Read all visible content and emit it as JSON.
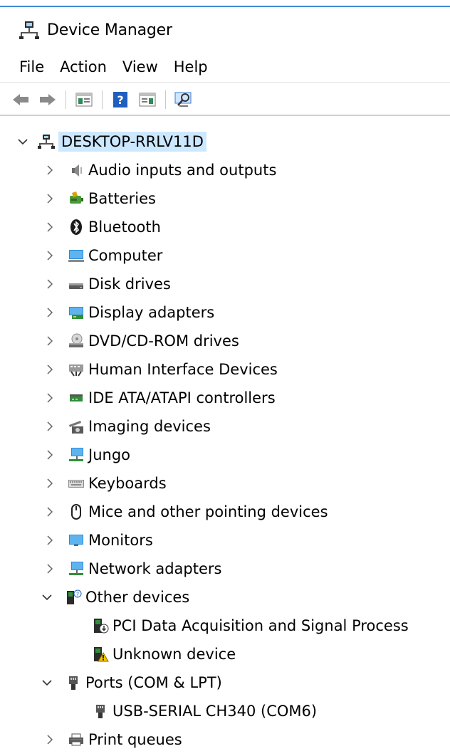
{
  "window": {
    "title": "Device Manager",
    "title_icon": "device-manager-icon"
  },
  "menu": [
    "File",
    "Action",
    "View",
    "Help"
  ],
  "toolbar": {
    "buttons": [
      "back-arrow-icon",
      "forward-arrow-icon",
      "show-hide-console-tree-icon",
      "help-icon",
      "show-hide-action-pane-icon",
      "scan-for-hardware-changes-icon"
    ]
  },
  "tree": {
    "root": {
      "label": "DESKTOP-RRLV11D",
      "expanded": true,
      "icon": "computer-network-icon",
      "selected": true
    },
    "categories": [
      {
        "label": "Audio inputs and outputs",
        "icon": "speaker-icon",
        "expanded": false
      },
      {
        "label": "Batteries",
        "icon": "battery-icon",
        "expanded": false
      },
      {
        "label": "Bluetooth",
        "icon": "bluetooth-icon",
        "expanded": false
      },
      {
        "label": "Computer",
        "icon": "computer-icon",
        "expanded": false
      },
      {
        "label": "Disk drives",
        "icon": "disk-drive-icon",
        "expanded": false
      },
      {
        "label": "Display adapters",
        "icon": "display-adapter-icon",
        "expanded": false
      },
      {
        "label": "DVD/CD-ROM drives",
        "icon": "dvd-drive-icon",
        "expanded": false
      },
      {
        "label": "Human Interface Devices",
        "icon": "hid-icon",
        "expanded": false
      },
      {
        "label": "IDE ATA/ATAPI controllers",
        "icon": "ide-controller-icon",
        "expanded": false
      },
      {
        "label": "Imaging devices",
        "icon": "camera-icon",
        "expanded": false
      },
      {
        "label": "Jungo",
        "icon": "network-device-icon",
        "expanded": false
      },
      {
        "label": "Keyboards",
        "icon": "keyboard-icon",
        "expanded": false
      },
      {
        "label": "Mice and other pointing devices",
        "icon": "mouse-icon",
        "expanded": false
      },
      {
        "label": "Monitors",
        "icon": "monitor-icon",
        "expanded": false
      },
      {
        "label": "Network adapters",
        "icon": "network-adapter-icon",
        "expanded": false
      },
      {
        "label": "Other devices",
        "icon": "unknown-device-category-icon",
        "expanded": true,
        "children": [
          {
            "label": "PCI Data Acquisition and Signal Process",
            "icon": "pci-device-icon"
          },
          {
            "label": "Unknown device",
            "icon": "warning-device-icon"
          }
        ]
      },
      {
        "label": "Ports (COM & LPT)",
        "icon": "port-icon",
        "expanded": true,
        "children": [
          {
            "label": "USB-SERIAL CH340 (COM6)",
            "icon": "port-icon"
          }
        ]
      },
      {
        "label": "Print queues",
        "icon": "printer-icon",
        "expanded": false
      }
    ]
  },
  "colors": {
    "selection": "#cce8ff",
    "accent": "#3c8bd0"
  }
}
